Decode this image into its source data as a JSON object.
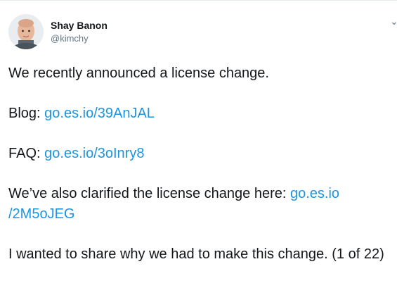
{
  "author": {
    "display_name": "Shay Banon",
    "handle": "@kimchy"
  },
  "more_icon": "chevron-down-icon",
  "tweet": {
    "line1": "We recently announced a license change.",
    "blog_label": "Blog:",
    "blog_link": "go.es.io/39AnJAL",
    "faq_label": "FAQ:",
    "faq_link": "go.es.io/3oInry8",
    "clarify_text": "We’ve also clarified the license change here:",
    "clarify_link": "go.es.io/2M5oJEG",
    "clarify_link_line1": "go.es.io",
    "clarify_link_line2": "/2M5oJEG",
    "final_text": "I wanted to share why we had to make this change. (1 of 22)"
  },
  "colors": {
    "link": "#1b95e0",
    "text": "#14171a",
    "muted": "#657786"
  }
}
